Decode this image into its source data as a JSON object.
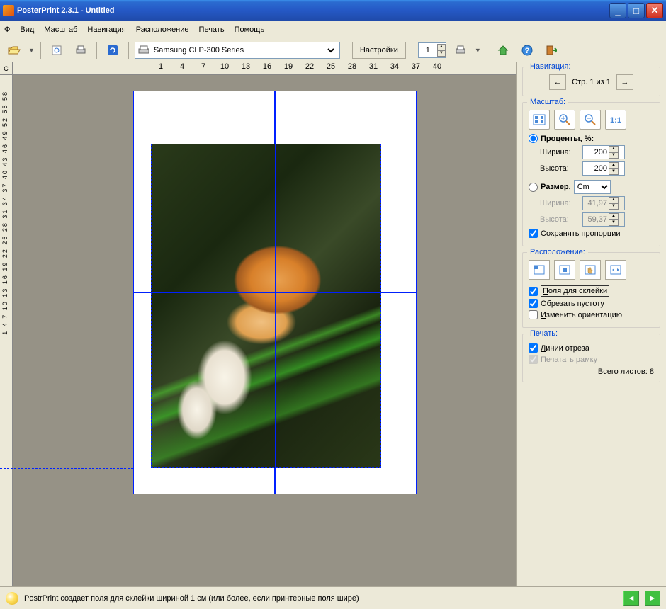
{
  "window": {
    "title": "PosterPrint 2.3.1 - Untitled"
  },
  "menu": {
    "file": "Файл",
    "view": "Вид",
    "scale": "Масштаб",
    "navigation": "Навигация",
    "position": "Расположение",
    "print": "Печать",
    "help": "Помощь"
  },
  "toolbar": {
    "printer": "Samsung CLP-300 Series",
    "settings": "Настройки",
    "copies": "1"
  },
  "ruler": {
    "h_ticks": [
      "1",
      "4",
      "7",
      "10",
      "13",
      "16",
      "19",
      "22",
      "25",
      "28",
      "31",
      "34",
      "37",
      "40"
    ],
    "v_label": "1  4  7  10 13 16 19 22 25 28 31 34 37 40 43 46 49 52 55 58",
    "corner": "С"
  },
  "side": {
    "nav": {
      "title": "Навигация:",
      "page_text": "Стр. 1 из 1"
    },
    "scale": {
      "title": "Масштаб:",
      "percent_label": "Проценты, %:",
      "size_label": "Размер,",
      "width_label": "Ширина:",
      "height_label": "Высота:",
      "width_pct": "200",
      "height_pct": "200",
      "unit": "Cm",
      "width_cm": "41,97",
      "height_cm": "59,37",
      "keep_aspect": "Сохранять пропорции"
    },
    "position": {
      "title": "Расположение:",
      "glue_margins": "Поля для склейки",
      "crop_empty": "Обрезать пустоту",
      "change_orient": "Изменить ориентацию"
    },
    "print": {
      "title": "Печать:",
      "cut_lines": "Линии отреза",
      "print_frame": "Печатать рамку",
      "total_label": "Всего листов:",
      "total_value": "8"
    }
  },
  "status": {
    "text": "PostrPrint создает поля для склейки шириной 1 см (или более, если принтерные поля шире)"
  }
}
